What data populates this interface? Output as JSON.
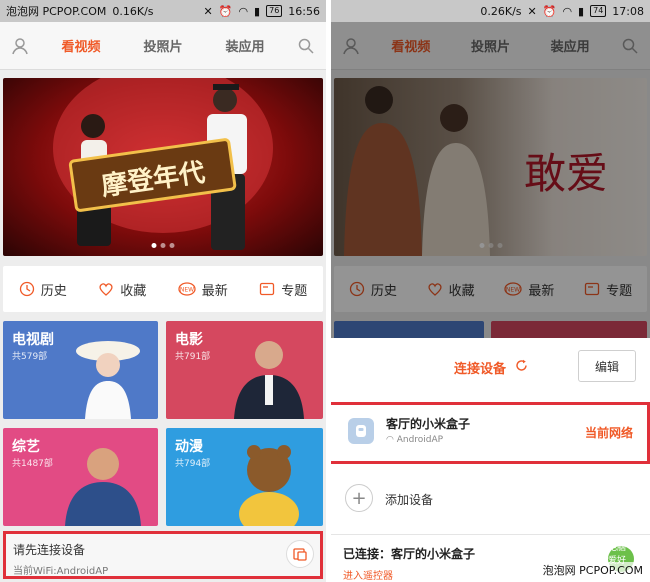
{
  "left": {
    "status": {
      "watermark": "泡泡网 PCPOP.COM",
      "speed": "0.16K/s",
      "battery": "76",
      "time": "16:56"
    },
    "nav": {
      "tabs": [
        "看视频",
        "投照片",
        "装应用"
      ],
      "active_tab": "看视频"
    },
    "banner": {
      "caption": "摩登年代"
    },
    "quick": [
      {
        "label": "历史",
        "icon": "clock-icon"
      },
      {
        "label": "收藏",
        "icon": "heart-icon"
      },
      {
        "label": "最新",
        "icon": "new-badge-icon"
      },
      {
        "label": "专题",
        "icon": "topic-card-icon"
      }
    ],
    "tiles": [
      {
        "title": "电视剧",
        "count": "共579部",
        "color": "#4f79c8"
      },
      {
        "title": "电影",
        "count": "共791部",
        "color": "#d5485f"
      },
      {
        "title": "综艺",
        "count": "共1487部",
        "color": "#e24b84"
      },
      {
        "title": "动漫",
        "count": "共794部",
        "color": "#2f9de0"
      }
    ],
    "prompt": {
      "title": "请先连接设备",
      "wifi": "当前WiFi:AndroidAP"
    }
  },
  "right": {
    "status": {
      "speed": "0.26K/s",
      "battery": "74",
      "time": "17:08"
    },
    "nav": {
      "tabs": [
        "看视频",
        "投照片",
        "装应用"
      ],
      "active_tab": "看视频"
    },
    "banner": {
      "caption": "敢爱"
    },
    "quick": [
      {
        "label": "历史",
        "icon": "clock-icon"
      },
      {
        "label": "收藏",
        "icon": "heart-icon"
      },
      {
        "label": "最新",
        "icon": "new-badge-icon"
      },
      {
        "label": "专题",
        "icon": "topic-card-icon"
      }
    ],
    "sheet": {
      "title": "连接设备",
      "edit": "编辑",
      "device_name": "客厅的小米盒子",
      "device_network": "AndroidAP",
      "device_status": "当前网络",
      "add_device": "添加设备",
      "connected": "已连接：客厅的小米盒子",
      "remote": "进入遥控器"
    },
    "watermark": "泡泡网 PCPOP.COM",
    "logo_watermark": "电脑爱好者"
  },
  "colors": {
    "accent": "#f05a28",
    "highlight_border": "#e0303a"
  }
}
